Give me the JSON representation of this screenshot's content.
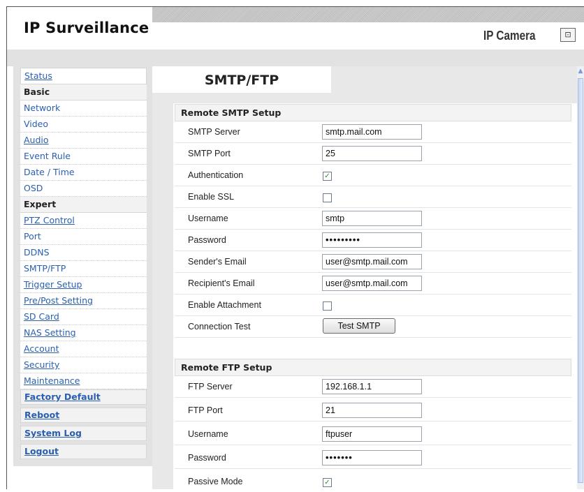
{
  "app": {
    "brand": "IP Surveillance",
    "product_name": "IP Camera",
    "product_icon_glyph": "⊡"
  },
  "sidebar": {
    "items": [
      {
        "label": "Status",
        "style": "link-blue box"
      },
      {
        "label": "Basic",
        "style": "header"
      },
      {
        "label": "Network",
        "style": "plain-blue"
      },
      {
        "label": "Video",
        "style": "plain-blue"
      },
      {
        "label": "Audio",
        "style": "link-blue"
      },
      {
        "label": "Event Rule",
        "style": "plain-blue"
      },
      {
        "label": "Date / Time",
        "style": "plain-blue"
      },
      {
        "label": "OSD",
        "style": "plain-blue"
      },
      {
        "label": "Expert",
        "style": "header"
      },
      {
        "label": "PTZ Control",
        "style": "link-blue"
      },
      {
        "label": "Port",
        "style": "plain-blue"
      },
      {
        "label": "DDNS",
        "style": "plain-blue"
      },
      {
        "label": "SMTP/FTP",
        "style": "plain-blue"
      },
      {
        "label": "Trigger Setup",
        "style": "link-blue"
      },
      {
        "label": "Pre/Post Setting",
        "style": "link-blue"
      },
      {
        "label": "SD Card",
        "style": "link-blue"
      },
      {
        "label": "NAS Setting",
        "style": "link-blue"
      },
      {
        "label": "Account",
        "style": "link-blue"
      },
      {
        "label": "Security",
        "style": "link-blue"
      },
      {
        "label": "Maintenance",
        "style": "link-blue"
      },
      {
        "label": "Factory Default",
        "style": "strong-link"
      },
      {
        "label": "Reboot",
        "style": "strong-link"
      },
      {
        "label": "System Log",
        "style": "strong-link"
      },
      {
        "label": "Logout",
        "style": "strong-link"
      }
    ]
  },
  "main": {
    "tab_title": "SMTP/FTP",
    "smtp": {
      "heading": "Remote SMTP Setup",
      "server_label": "SMTP Server",
      "server_value": "smtp.mail.com",
      "port_label": "SMTP Port",
      "port_value": "25",
      "auth_label": "Authentication",
      "auth_checked": true,
      "ssl_label": "Enable SSL",
      "ssl_checked": false,
      "username_label": "Username",
      "username_value": "smtp",
      "password_label": "Password",
      "password_value": "•••••••••",
      "sender_label": "Sender's Email",
      "sender_value": "user@smtp.mail.com",
      "recipient_label": "Recipient's Email",
      "recipient_value": "user@smtp.mail.com",
      "attachment_label": "Enable Attachment",
      "attachment_checked": false,
      "test_label": "Connection Test",
      "test_button": "Test SMTP"
    },
    "ftp": {
      "heading": "Remote FTP Setup",
      "server_label": "FTP Server",
      "server_value": "192.168.1.1",
      "port_label": "FTP Port",
      "port_value": "21",
      "username_label": "Username",
      "username_value": "ftpuser",
      "password_label": "Password",
      "password_value": "•••••••",
      "passive_label": "Passive Mode",
      "passive_checked": true
    }
  },
  "colors": {
    "link": "#2a5fb0",
    "check": "#2e8b2e",
    "panel_bg": "#e2e2e2"
  }
}
